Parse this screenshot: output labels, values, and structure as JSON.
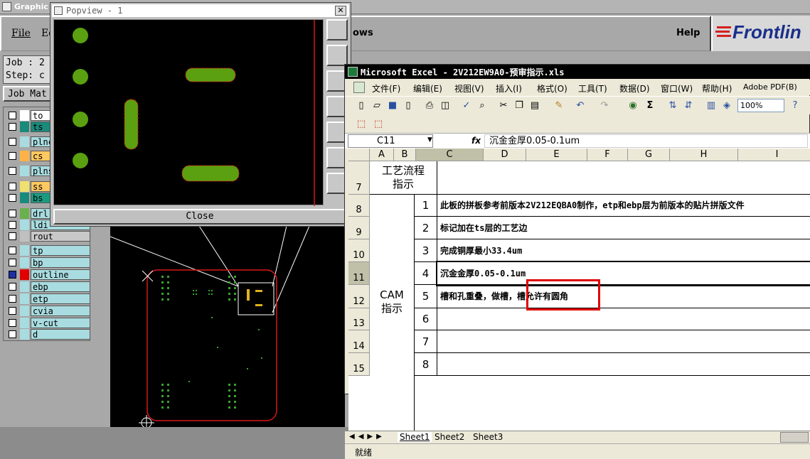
{
  "genesis": {
    "title": "Graphic",
    "menu": [
      "File",
      "Ed",
      "ows",
      "Help"
    ],
    "logo": "Frontlin",
    "job_line": "Job : 2",
    "step_line": "Step: c",
    "job_matrix": "Job Mat",
    "layers": [
      {
        "name": "to",
        "color": "#ffffff",
        "bg": "#ffffff"
      },
      {
        "name": "ts",
        "color": "#1a8a7a",
        "bg": "#1a8a7a"
      },
      {
        "name": "plnc",
        "color": "#a8dce0",
        "bg": "#a8dce0"
      },
      {
        "name": "cs",
        "color": "#ffb347",
        "bg": "#ffc860"
      },
      {
        "name": "plns",
        "color": "#a8dce0",
        "bg": "#a8dce0"
      },
      {
        "name": "ss",
        "color": "#f0e070",
        "bg": "#ffc860"
      },
      {
        "name": "bs",
        "color": "#1a8a7a",
        "bg": "#1a9a80"
      },
      {
        "name": "drl",
        "color": "#6ab04c",
        "bg": "#a8dce0"
      },
      {
        "name": "ldi",
        "color": "#a8dce0",
        "bg": "#a8dce0"
      },
      {
        "name": "rout",
        "color": "#c0c0c0",
        "bg": "#c8c8c8"
      },
      {
        "name": "tp",
        "color": "#a8dce0",
        "bg": "#a8dce0"
      },
      {
        "name": "bp",
        "color": "#a8dce0",
        "bg": "#a8dce0"
      },
      {
        "name": "outline",
        "color": "#e00000",
        "bg": "#a8dce0"
      },
      {
        "name": "ebp",
        "color": "#a8dce0",
        "bg": "#a8dce0"
      },
      {
        "name": "etp",
        "color": "#a8dce0",
        "bg": "#a8dce0"
      },
      {
        "name": "cvia",
        "color": "#a8dce0",
        "bg": "#a8dce0"
      },
      {
        "name": "v-cut",
        "color": "#a8dce0",
        "bg": "#a8dce0"
      },
      {
        "name": "d",
        "color": "#a8dce0",
        "bg": "#a8dce0"
      }
    ]
  },
  "popview": {
    "title": "Popview - 1",
    "close_label": "Close",
    "close_x": "✕"
  },
  "excel": {
    "title": "Microsoft Excel - 2V212EW9A0-预审指示.xls",
    "menu": [
      "文件(F)",
      "编辑(E)",
      "视图(V)",
      "插入(I)",
      "格式(O)",
      "工具(T)",
      "数据(D)",
      "窗口(W)",
      "帮助(H)",
      "Adobe PDF(B)"
    ],
    "zoom": "100%",
    "name_box": "C11",
    "fx": "fx",
    "formula": "沉金金厚0.05-0.1um",
    "columns": [
      "A",
      "B",
      "C",
      "D",
      "E",
      "F",
      "G",
      "H",
      "I"
    ],
    "row_numbers": [
      "7",
      "8",
      "9",
      "10",
      "11",
      "12",
      "13",
      "14",
      "15"
    ],
    "a7": "工艺流程\n指示",
    "a_cam": "CAM\n指示",
    "rows": [
      {
        "num": "1",
        "text": "此板的拼板参考前版本2V212EQBA0制作，etp和ebp层为前版本的贴片拼版文件"
      },
      {
        "num": "2",
        "text": "标记加在ts层的工艺边"
      },
      {
        "num": "3",
        "text": "完成铜厚最小33.4um"
      },
      {
        "num": "4",
        "text": "沉金金厚0.05-0.1um"
      },
      {
        "num": "5",
        "text": "槽和孔重叠，做槽，槽允许有圆角"
      },
      {
        "num": "6",
        "text": ""
      },
      {
        "num": "7",
        "text": ""
      },
      {
        "num": "8",
        "text": ""
      }
    ],
    "sheets": [
      "Sheet1",
      "Sheet2",
      "Sheet3"
    ],
    "status": "就绪"
  }
}
